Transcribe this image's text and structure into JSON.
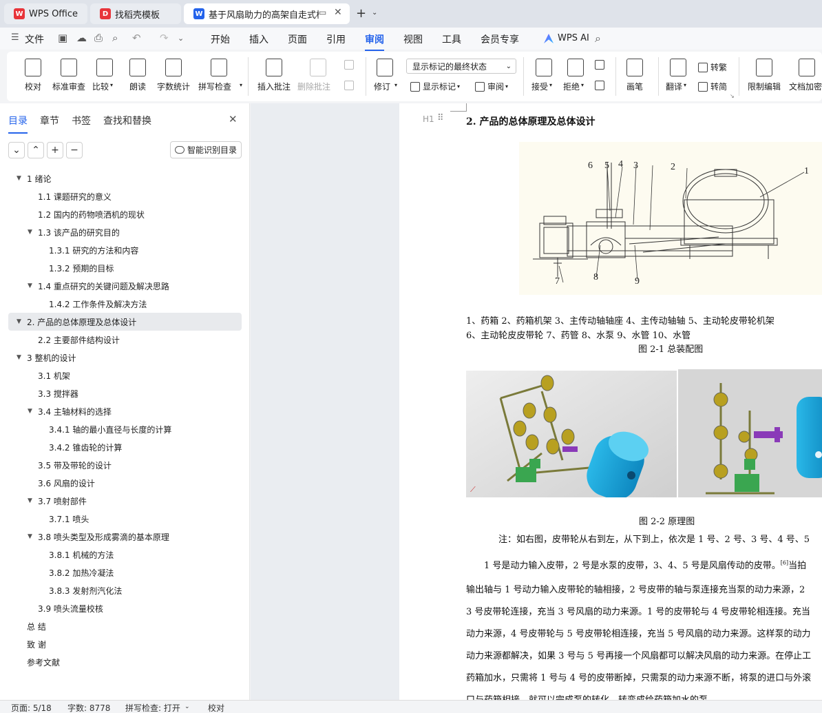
{
  "tabs": [
    {
      "label": "WPS Office"
    },
    {
      "label": "找稻壳模板"
    },
    {
      "label": "基于风扇助力的高架自走式棉花"
    }
  ],
  "menu": {
    "file": "文件",
    "items": [
      "开始",
      "插入",
      "页面",
      "引用",
      "审阅",
      "视图",
      "工具",
      "会员专享"
    ],
    "active": "审阅",
    "ai": "WPS AI"
  },
  "ribbon": {
    "proofread": "校对",
    "standard_review": "标准审查",
    "compare": "比较",
    "read_aloud": "朗读",
    "word_count": "字数统计",
    "spell_check": "拼写检查",
    "insert_comment": "插入批注",
    "delete_comment": "删除批注",
    "track": "修订",
    "display_state": "显示标记的最终状态",
    "show_markup": "显示标记",
    "review": "审阅",
    "accept": "接受",
    "reject": "拒绝",
    "pen": "画笔",
    "translate": "翻译",
    "to_traditional": "转繁",
    "to_simplified": "转简",
    "restrict_edit": "限制编辑",
    "doc_encrypt": "文档加密"
  },
  "panel": {
    "tabs": [
      "目录",
      "章节",
      "书签",
      "查找和替换"
    ],
    "smart_button": "智能识别目录",
    "toc": [
      {
        "text": "1  绪论",
        "level": 0,
        "arrow": true
      },
      {
        "text": "1.1 课题研究的意义",
        "level": 1
      },
      {
        "text": "1.2 国内的药物喷洒机的现状",
        "level": 1
      },
      {
        "text": "1.3  该产品的研究目的",
        "level": 1,
        "arrow": true
      },
      {
        "text": "1.3.1  研究的方法和内容",
        "level": 2
      },
      {
        "text": "1.3.2 预期的目标",
        "level": 2
      },
      {
        "text": "1.4 重点研究的关键问题及解决思路",
        "level": 1,
        "arrow": true
      },
      {
        "text": "1.4.2 工作条件及解决方法",
        "level": 2
      },
      {
        "text": "2.  产品的总体原理及总体设计",
        "level": 0,
        "arrow": true,
        "selected": true
      },
      {
        "text": "2.2  主要部件结构设计",
        "level": 1
      },
      {
        "text": "3  整机的设计",
        "level": 0,
        "arrow": true
      },
      {
        "text": "3.1  机架",
        "level": 1
      },
      {
        "text": "3.3  搅拌器",
        "level": 1
      },
      {
        "text": "3.4  主轴材料的选择",
        "level": 1,
        "arrow": true
      },
      {
        "text": "3.4.1  轴的最小直径与长度的计算",
        "level": 2
      },
      {
        "text": "3.4.2  锥齿轮的计算",
        "level": 2
      },
      {
        "text": "3.5  带及带轮的设计",
        "level": 1
      },
      {
        "text": "3.6  风扇的设计",
        "level": 1
      },
      {
        "text": "3.7 喷射部件",
        "level": 1,
        "arrow": true
      },
      {
        "text": "3.7.1  喷头",
        "level": 2
      },
      {
        "text": "3.8 喷头类型及形成雾滴的基本原理",
        "level": 1,
        "arrow": true
      },
      {
        "text": "3.8.1  机械的方法",
        "level": 2
      },
      {
        "text": "3.8.2  加热冷凝法",
        "level": 2
      },
      {
        "text": "3.8.3  发射剂汽化法",
        "level": 2
      },
      {
        "text": "3.9  喷头流量校核",
        "level": 1
      },
      {
        "text": "总   结",
        "level": 0
      },
      {
        "text": "致   谢",
        "level": 0
      },
      {
        "text": "参考文献",
        "level": 0
      }
    ]
  },
  "doc": {
    "heading_marker": "H1",
    "heading": "2. 产品的总体原理及总体设计",
    "drawing_labels": [
      "6",
      "5",
      "4",
      "3",
      "2",
      "1",
      "7",
      "8",
      "9"
    ],
    "legend_line1": "1、药箱  2、药箱机架  3、主传动轴轴座  4、主传动轴轴  5、主动轮皮带轮机架",
    "legend_line2": "6、主动轮皮皮带轮     7、药管   8、水泵   9、水管  10、水管",
    "fig1_caption": "图  2-1 总装配图",
    "fig2_caption": "图  2-2    原理图",
    "note": "注：如右图，皮带轮从右到左，从下到上，依次是 1 号、2 号、3 号、4 号、5",
    "para_start": "1 号是动力输入皮带，2 号是水泵的皮带，3、4、5 号是风扇传动的皮带。",
    "cite": "[6]",
    "para_end": "当拍",
    "lines": [
      "输出轴与 1 号动力输入皮带轮的轴相接，2 号皮带的轴与泵连接充当泵的动力来源，2",
      "3 号皮带轮连接，充当 3 号风扇的动力来源。1 号的皮带轮与 4 号皮带轮相连接。充当",
      "动力来源，4 号皮带轮与 5 号皮带轮相连接，充当 5 号风扇的动力来源。这样泵的动力",
      "动力来源都解决，如果 3 号与 5 号再接一个风扇都可以解决风扇的动力来源。在停止工",
      "药箱加水，只需将 1 号与 4 号的皮带断掉，只需泵的动力来源不断，将泵的进口与外滚",
      "口与药箱相接，就可以完成泵的转化，转变成给药箱加水的泵。"
    ]
  },
  "status": {
    "page": "页面: 5/18",
    "words": "字数: 8778",
    "spell": "拼写检查: 打开",
    "proof": "校对"
  }
}
